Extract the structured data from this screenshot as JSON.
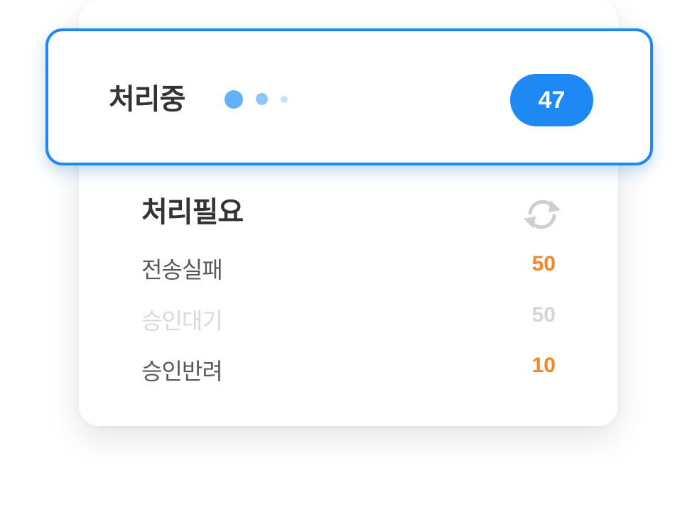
{
  "processing": {
    "title": "처리중",
    "count": "47"
  },
  "needs_action": {
    "title": "처리필요",
    "refresh_icon": "refresh-icon",
    "items": [
      {
        "label": "전송실패",
        "value": "50",
        "state": "active",
        "color": "#f5862a"
      },
      {
        "label": "승인대기",
        "value": "50",
        "state": "disabled",
        "color": "#d6d6d6"
      },
      {
        "label": "승인반려",
        "value": "10",
        "state": "active",
        "color": "#f5862a"
      }
    ]
  },
  "colors": {
    "accent": "#1e88f5",
    "warning": "#f5862a",
    "text": "#333333",
    "muted": "#595959",
    "disabled": "#d9d9d9"
  }
}
